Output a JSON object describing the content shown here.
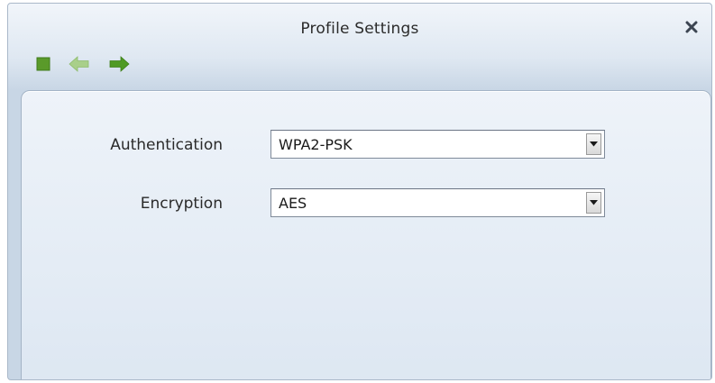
{
  "window": {
    "title": "Profile Settings"
  },
  "toolbar": {
    "icons": [
      "stop-icon",
      "back-arrow-icon",
      "forward-arrow-icon"
    ],
    "colors": {
      "stop": "#5a9a2a",
      "back": "#a9cf8a",
      "forward": "#4f9a24"
    }
  },
  "form": {
    "authentication": {
      "label": "Authentication",
      "value": "WPA2-PSK"
    },
    "encryption": {
      "label": "Encryption",
      "value": "AES"
    }
  },
  "icons": {
    "close": "close-icon",
    "dropdown": "dropdown-arrow-icon"
  }
}
